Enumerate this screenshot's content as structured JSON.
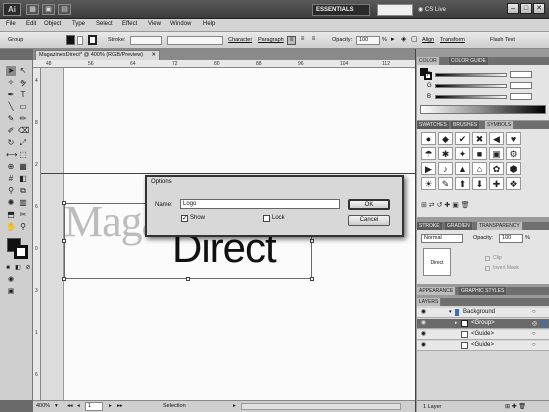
{
  "app": {
    "logo": "Ai"
  },
  "titlebar": {
    "workspace": "ESSENTIALS",
    "cs_live": "CS Live",
    "minimize": "–",
    "maximize": "□",
    "close": "✕"
  },
  "menu": [
    "File",
    "Edit",
    "Object",
    "Type",
    "Select",
    "Effect",
    "View",
    "Window",
    "Help"
  ],
  "control_bar": {
    "selection_label": "Group",
    "stroke_label": "Stroke:",
    "character_label": "Character",
    "paragraph_label": "Paragraph",
    "opacity_label": "Opacity:",
    "opacity_value": "100",
    "opacity_unit": "%",
    "align_label": "Align",
    "transform_label": "Transform",
    "flash_text_label": "Flash Text"
  },
  "document": {
    "tab_title": "MagazinesDirect* @ 400% (RGB/Preview)"
  },
  "ruler": {
    "top_ticks": [
      "48",
      "56",
      "64",
      "72",
      "80",
      "88",
      "96",
      "104",
      "112"
    ],
    "left_ticks": [
      "4",
      "8",
      "2",
      "6",
      "0",
      "3",
      "1",
      "6"
    ]
  },
  "artwork": {
    "text_gray": "Magazines",
    "text_black": "Direct"
  },
  "dialog": {
    "title": "Options",
    "name_label": "Name:",
    "name_value": "Logo",
    "show_label": "Show",
    "show_checked": true,
    "lock_label": "Lock",
    "lock_checked": false,
    "ok_label": "OK",
    "cancel_label": "Cancel"
  },
  "status": {
    "zoom": "400%",
    "page": "1",
    "mode": "Selection"
  },
  "color_panel": {
    "tab_color": "COLOR",
    "tab_guide": "COLOR GUIDE",
    "r_label": "R",
    "g_label": "G",
    "b_label": "B"
  },
  "swatches_panel": {
    "tab_swatches": "SWATCHES",
    "tab_brushes": "BRUSHES",
    "tab_symbols": "SYMBOLS",
    "symbols": [
      "●",
      "◆",
      "✔",
      "✖",
      "◀",
      "♥",
      "☂",
      "✱",
      "✦",
      "■",
      "▣",
      "⚙",
      "▶",
      "♪",
      "▲",
      "⌂",
      "✿",
      "⬢",
      "☀",
      "✎",
      "⬆",
      "⬇",
      "✚",
      "❖"
    ]
  },
  "stroke_panel": {
    "tab_stroke": "STROKE",
    "tab_gradient": "GRADIEN",
    "tab_transparency": "TRANSPARENCY",
    "blend_mode": "Normal",
    "opacity_label": "Opacity:",
    "opacity_value": "100",
    "opacity_unit": "%",
    "thumb_text": "Direct",
    "clip_label": "Clip",
    "invert_mask_label": "Invert Mask"
  },
  "appearance_panel": {
    "tab_appearance": "APPEARANCE",
    "tab_graphic_styles": "GRAPHIC STYLES"
  },
  "layers_panel": {
    "tab_layers": "LAYERS",
    "rows": [
      {
        "name": "Background"
      },
      {
        "name": "<Group>"
      },
      {
        "name": "<Guide>"
      },
      {
        "name": "<Guide>"
      }
    ],
    "count": "1 Layer"
  },
  "colors": {
    "accent_dark": "#3c3c3c",
    "panel_bg": "#e4e4e4",
    "selected_row": "#6a6a6a"
  }
}
